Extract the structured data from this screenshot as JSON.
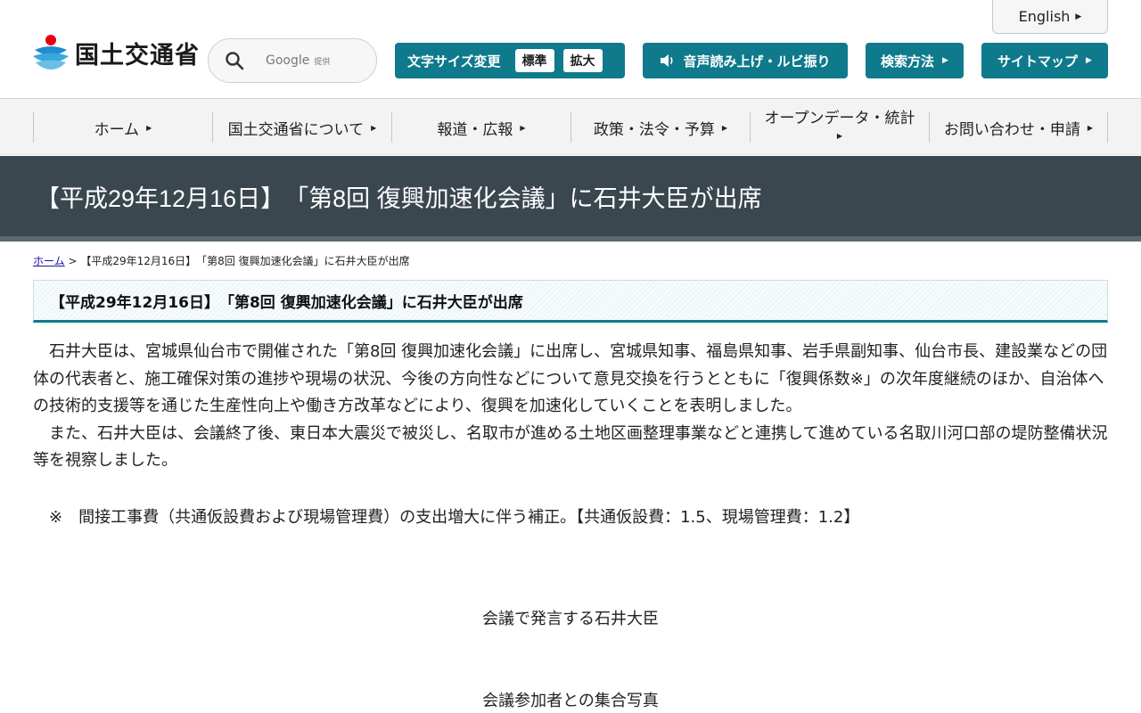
{
  "header": {
    "english_label": "English",
    "logo_text": "国土交通省",
    "search": {
      "placeholder": "Google",
      "provider_suffix": "提供"
    },
    "text_size": {
      "label": "文字サイズ変更",
      "standard": "標準",
      "large": "拡大"
    },
    "voice_label": "音声読み上げ・ルビ振り",
    "search_howto_label": "検索方法",
    "sitemap_label": "サイトマップ",
    "accent_color": "#0e7a8c"
  },
  "nav": {
    "items": [
      {
        "label": "ホーム"
      },
      {
        "label": "国土交通省について"
      },
      {
        "label": "報道・広報"
      },
      {
        "label": "政策・法令・予算"
      },
      {
        "label": "オープンデータ・統計"
      },
      {
        "label": "お問い合わせ・申請"
      }
    ]
  },
  "page": {
    "title": "【平成29年12月16日】　「第8回 復興加速化会議」に石井大臣が出席",
    "breadcrumb": {
      "home": "ホーム",
      "separator": ">",
      "current": "【平成29年12月16日】　「第8回 復興加速化会議」に石井大臣が出席"
    },
    "heading": "【平成29年12月16日】　「第8回 復興加速化会議」に石井大臣が出席",
    "banner_color": "#3a474f"
  },
  "article": {
    "paragraph_1": "　石井大臣は、宮城県仙台市で開催された「第8回 復興加速化会議」に出席し、宮城県知事、福島県知事、岩手県副知事、仙台市長、建設業などの団体の代表者と、施工確保対策の進捗や現場の状況、今後の方向性などについて意見交換を行うとともに「復興係数※」の次年度継続のほか、自治体への技術的支援等を通じた生産性向上や働き方改革などにより、復興を加速化していくことを表明しました。",
    "paragraph_2": "　また、石井大臣は、会議終了後、東日本大震災で被災し、名取市が進める土地区画整理事業などと連携して進めている名取川河口部の堤防整備状況等を視察しました。",
    "note": "　※　間接工事費（共通仮設費および現場管理費）の支出増大に伴う補正。【共通仮設費：1.5、現場管理費：1.2】",
    "caption_1": "会議で発言する石井大臣",
    "caption_2": "会議参加者との集合写真"
  }
}
